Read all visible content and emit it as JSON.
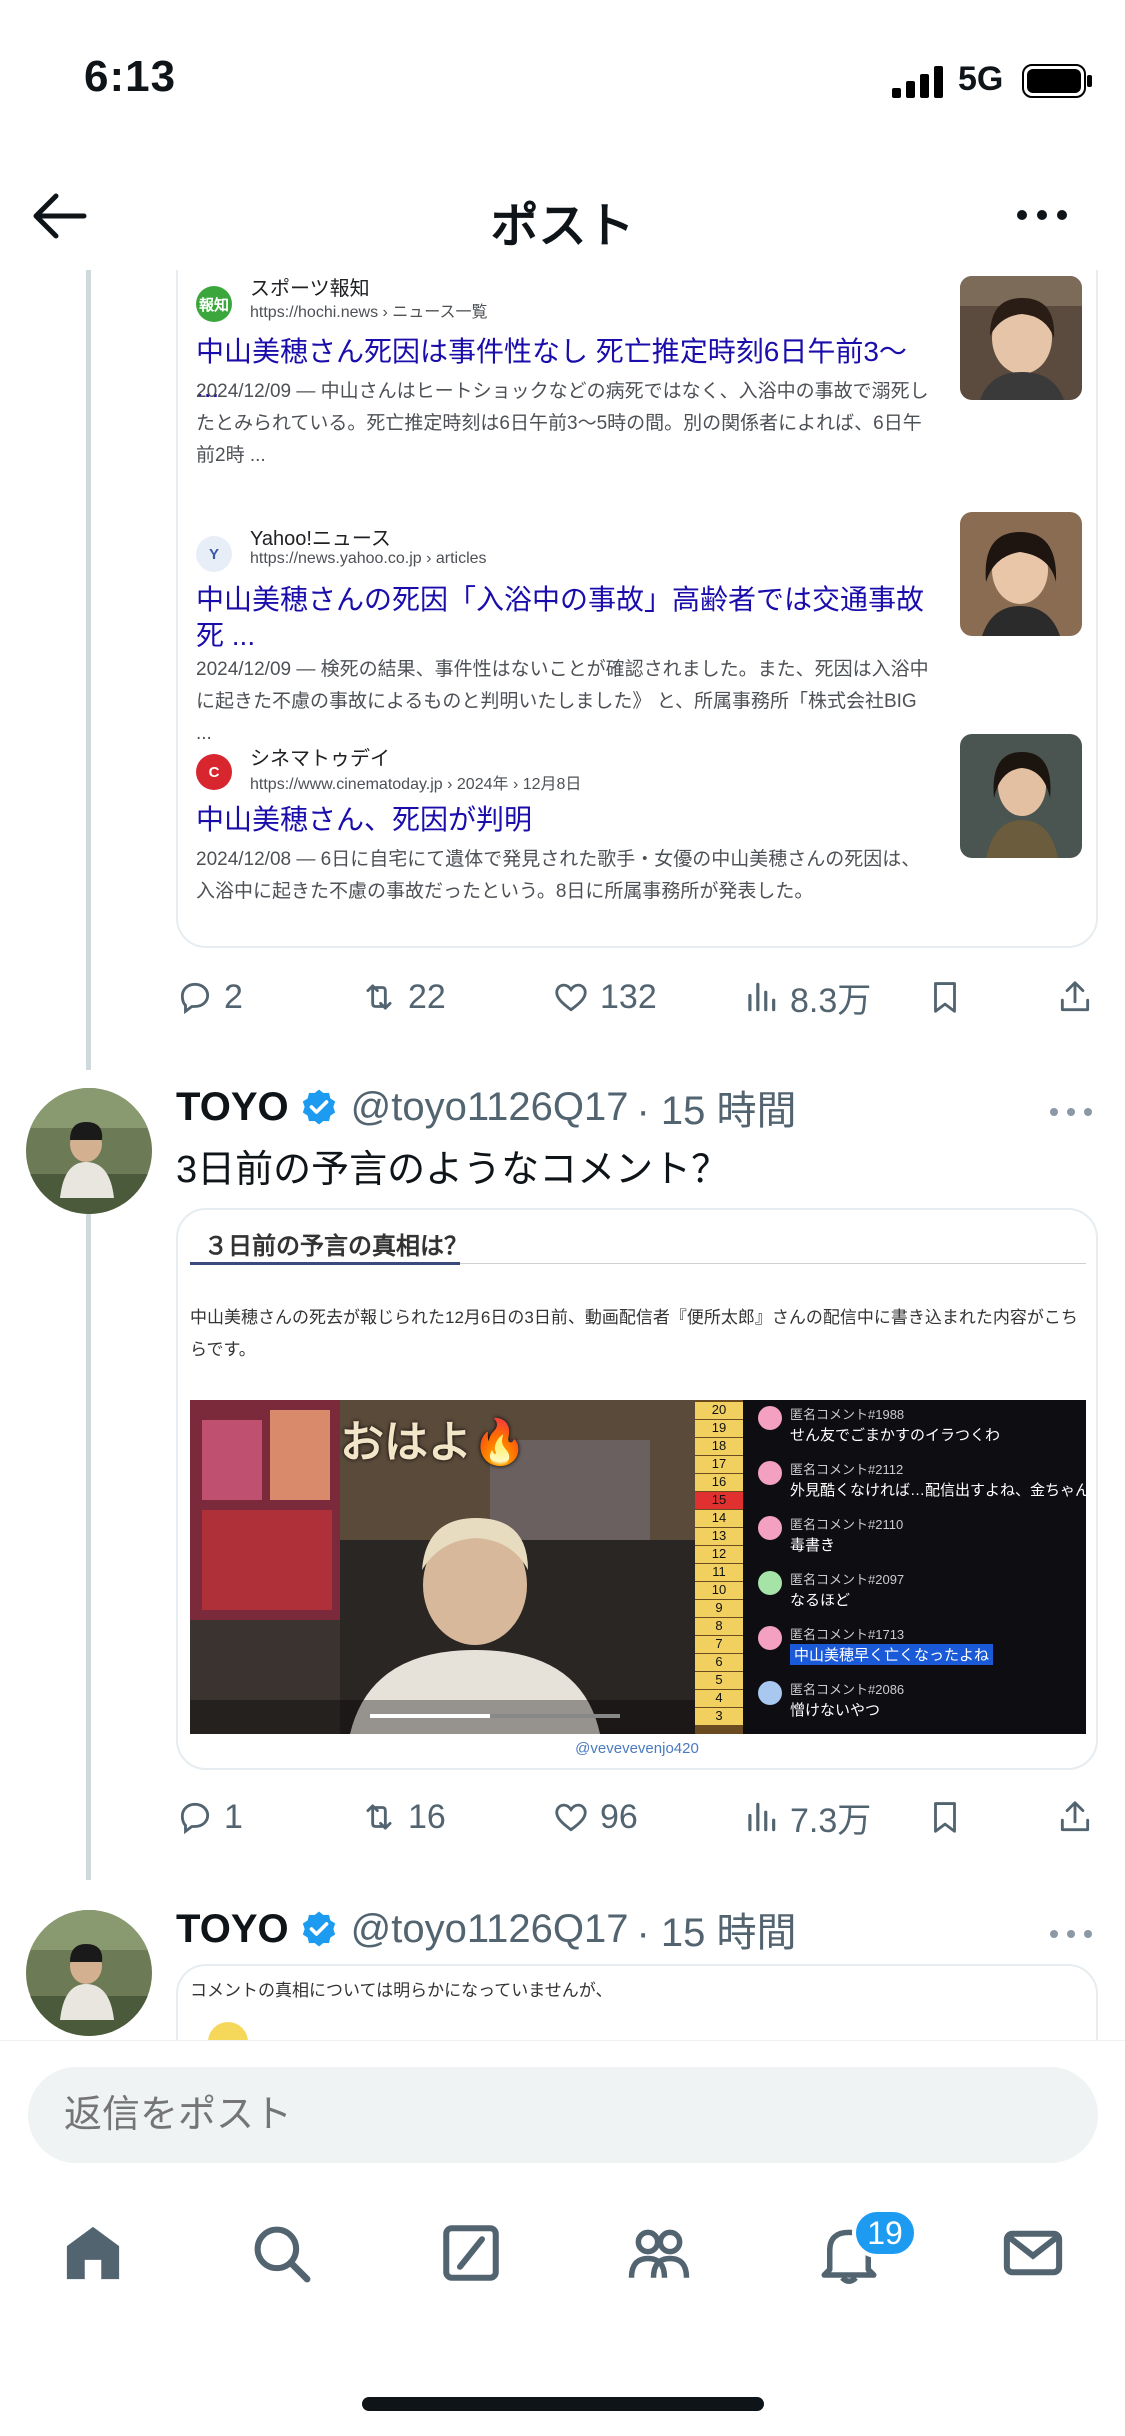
{
  "status": {
    "time": "6:13",
    "network": "5G"
  },
  "header": {
    "title": "ポスト"
  },
  "search_results": [
    {
      "site": "スポーツ報知",
      "url": "https://hochi.news › ニュース一覧",
      "title": "中山美穂さん死因は事件性なし 死亡推定時刻6日午前3〜 ...",
      "snippet": "2024/12/09 — 中山さんはヒートショックなどの病死ではなく、入浴中の事故で溺死したとみられている。死亡推定時刻は6日午前3〜5時の間。別の関係者によれば、6日午前2時 ...",
      "favicon": "報知"
    },
    {
      "site": "Yahoo!ニュース",
      "url": "https://news.yahoo.co.jp › articles",
      "title": "中山美穂さんの死因「入浴中の事故」高齢者では交通事故死 ...",
      "snippet": "2024/12/09 — 検死の結果、事件性はないことが確認されました。また、死因は入浴中に起きた不慮の事故によるものと判明いたしました》 と、所属事務所「株式会社BIG ...",
      "favicon": "Y"
    },
    {
      "site": "シネマトゥデイ",
      "url": "https://www.cinematoday.jp › 2024年 › 12月8日",
      "title": "中山美穂さん、死因が判明",
      "snippet": "2024/12/08 — 6日に自宅にて遺体で発見された歌手・女優の中山美穂さんの死因は、入浴中に起きた不慮の事故だったという。8日に所属事務所が発表した。",
      "favicon": "C"
    }
  ],
  "post1_actions": {
    "replies": "2",
    "reposts": "22",
    "likes": "132",
    "views": "8.3万"
  },
  "post2": {
    "name": "TOYO",
    "handle": "@toyo1126Q17",
    "time": "· 15 時間",
    "text": "3日前の予言のようなコメント？",
    "card": {
      "tab": "３日前の予言の真相は？",
      "desc": "中山美穂さんの死去が報じられた12月6日の3日前、動画配信者『便所太郎』さんの配信中に書き込まれた内容がこちらです。",
      "credit": "@vevevevenjo420",
      "video_banner": "おはよ🔥",
      "comments": [
        {
          "user": "匿名コメント#1988",
          "text": "せん友でごまかすのイラつくわ",
          "color": "#f4a0c0"
        },
        {
          "user": "匿名コメント#2112",
          "text": "外見酷くなければ…配信出すよね、金ちゃん",
          "color": "#f4a0c0"
        },
        {
          "user": "匿名コメント#2110",
          "text": "毒書き",
          "color": "#f4a0c0"
        },
        {
          "user": "匿名コメント#2097",
          "text": "なるほど",
          "color": "#a6e3a6"
        },
        {
          "user": "匿名コメント#1713",
          "text": "中山美穂早く亡くなったよね",
          "color": "#f4a0c0",
          "highlight": true
        },
        {
          "user": "匿名コメント#2086",
          "text": "憎けないやつ",
          "color": "#a8c8f0"
        }
      ],
      "ladder": [
        "20",
        "19",
        "18",
        "17",
        "16",
        "15",
        "14",
        "13",
        "12",
        "11",
        "10",
        "9",
        "8",
        "7",
        "6",
        "5",
        "4",
        "3"
      ]
    },
    "actions": {
      "replies": "1",
      "reposts": "16",
      "likes": "96",
      "views": "7.3万"
    }
  },
  "post3": {
    "name": "TOYO",
    "handle": "@toyo1126Q17",
    "time": "· 15 時間",
    "card_text": "コメントの真相については明らかになっていませんが、"
  },
  "compose": {
    "placeholder": "返信をポスト"
  },
  "notifications_badge": "19",
  "colors": {
    "accent": "#1d9bf0",
    "link": "#1a0dab",
    "muted": "#536471"
  }
}
